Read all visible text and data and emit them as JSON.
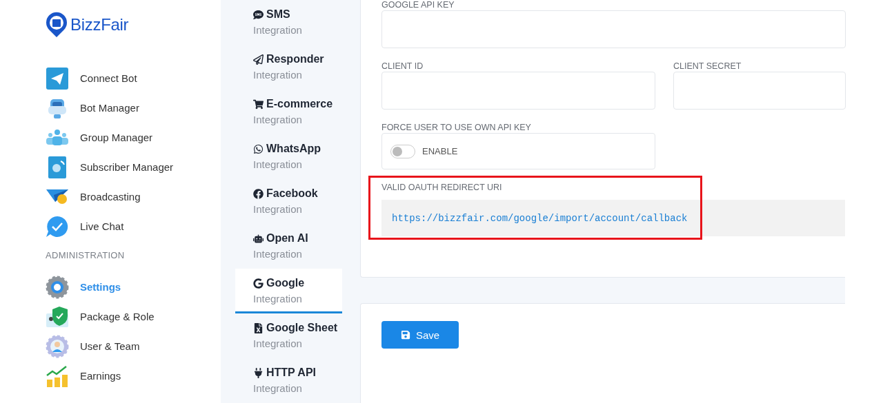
{
  "logo": {
    "text": "BizzFair"
  },
  "sidebar": {
    "items": [
      {
        "label": "Connect Bot",
        "selected": false
      },
      {
        "label": "Bot Manager",
        "selected": false
      },
      {
        "label": "Group Manager",
        "selected": false
      },
      {
        "label": "Subscriber Manager",
        "selected": false
      },
      {
        "label": "Broadcasting",
        "selected": false
      },
      {
        "label": "Live Chat",
        "selected": false
      }
    ],
    "section_header": "ADMINISTRATION",
    "admin_items": [
      {
        "label": "Settings",
        "selected": true
      },
      {
        "label": "Package & Role",
        "selected": false
      },
      {
        "label": "User & Team",
        "selected": false
      },
      {
        "label": "Earnings",
        "selected": false
      }
    ]
  },
  "integration_tabs": [
    {
      "title": "SMS",
      "subtitle": "Integration",
      "selected": false
    },
    {
      "title": "Responder",
      "subtitle": "Integration",
      "selected": false
    },
    {
      "title": "E-commerce",
      "subtitle": "Integration",
      "selected": false
    },
    {
      "title": "WhatsApp",
      "subtitle": "Integration",
      "selected": false
    },
    {
      "title": "Facebook",
      "subtitle": "Integration",
      "selected": false
    },
    {
      "title": "Open AI",
      "subtitle": "Integration",
      "selected": false
    },
    {
      "title": "Google",
      "subtitle": "Integration",
      "selected": true
    },
    {
      "title": "Google Sheet",
      "subtitle": "Integration",
      "selected": false
    },
    {
      "title": "HTTP API",
      "subtitle": "Integration",
      "selected": false
    }
  ],
  "form": {
    "google_api_key": {
      "label": "GOOGLE API KEY"
    },
    "client_id": {
      "label": "CLIENT ID"
    },
    "client_secret": {
      "label": "CLIENT SECRET"
    },
    "force_own_key": {
      "label": "FORCE USER TO USE OWN API KEY",
      "toggle_label": "ENABLE",
      "on": false
    },
    "redirect_uri": {
      "label": "VALID OAUTH REDIRECT URI",
      "value": "https://bizzfair.com/google/import/account/callback",
      "highlighted": true
    }
  },
  "save_button": {
    "label": "Save"
  }
}
